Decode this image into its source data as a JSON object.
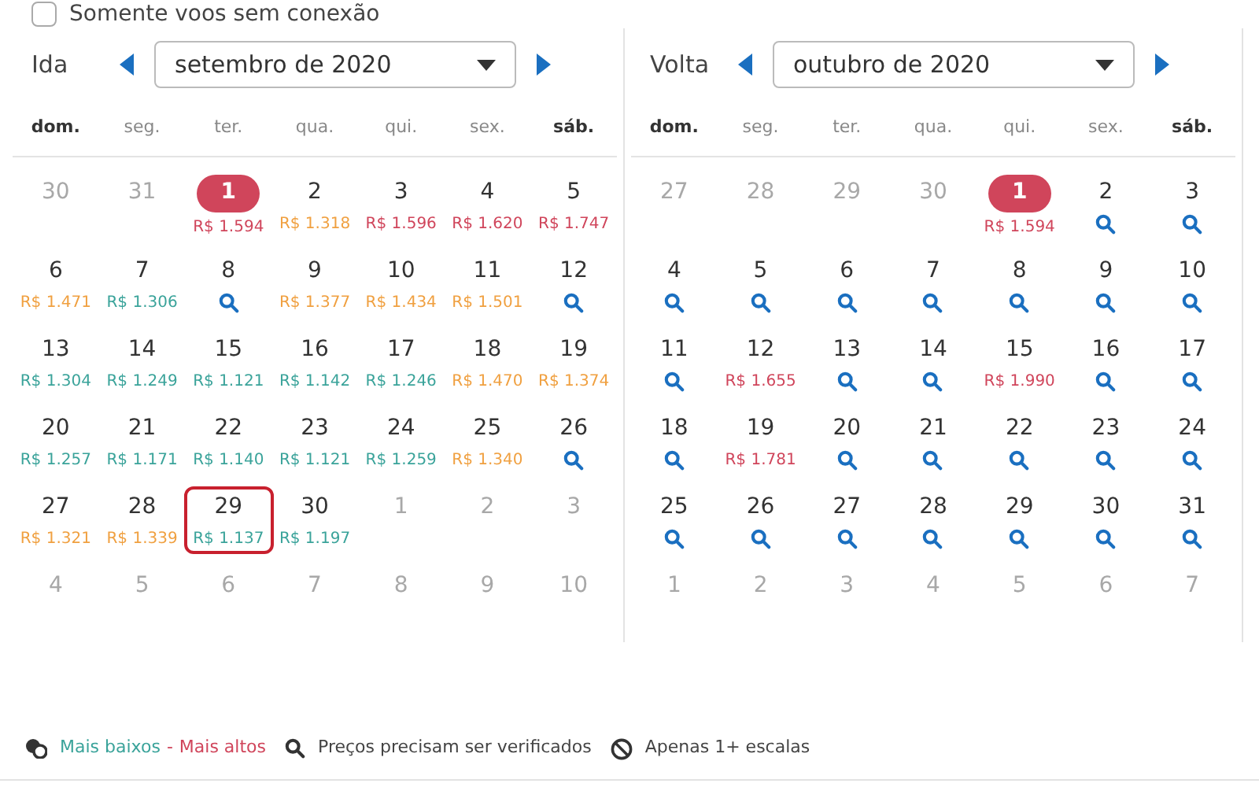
{
  "filter": {
    "label": "Somente voos sem conexão",
    "checked": false
  },
  "calendars": [
    {
      "label": "Ida",
      "month": "setembro de 2020",
      "weekdays": [
        {
          "text": "dom.",
          "weekend": true
        },
        {
          "text": "seg.",
          "weekend": false
        },
        {
          "text": "ter.",
          "weekend": false
        },
        {
          "text": "qua.",
          "weekend": false
        },
        {
          "text": "qui.",
          "weekend": false
        },
        {
          "text": "sex.",
          "weekend": false
        },
        {
          "text": "sáb.",
          "weekend": true
        }
      ],
      "days": [
        {
          "day": "30",
          "kind": "other"
        },
        {
          "day": "31",
          "kind": "other"
        },
        {
          "day": "1",
          "kind": "price",
          "price": "R$ 1.594",
          "color": "#d0455b",
          "selected": true,
          "outlined": false
        },
        {
          "day": "2",
          "kind": "price",
          "price": "R$ 1.318",
          "color": "#f0a040",
          "selected": false,
          "outlined": false
        },
        {
          "day": "3",
          "kind": "price",
          "price": "R$ 1.596",
          "color": "#d0455b",
          "selected": false,
          "outlined": false
        },
        {
          "day": "4",
          "kind": "price",
          "price": "R$ 1.620",
          "color": "#d0455b",
          "selected": false,
          "outlined": false
        },
        {
          "day": "5",
          "kind": "price",
          "price": "R$ 1.747",
          "color": "#d0455b",
          "selected": false,
          "outlined": false
        },
        {
          "day": "6",
          "kind": "price",
          "price": "R$ 1.471",
          "color": "#f0a040",
          "selected": false,
          "outlined": false
        },
        {
          "day": "7",
          "kind": "price",
          "price": "R$ 1.306",
          "color": "#3aa39a",
          "selected": false,
          "outlined": false
        },
        {
          "day": "8",
          "kind": "search",
          "selected": false,
          "outlined": false
        },
        {
          "day": "9",
          "kind": "price",
          "price": "R$ 1.377",
          "color": "#f0a040",
          "selected": false,
          "outlined": false
        },
        {
          "day": "10",
          "kind": "price",
          "price": "R$ 1.434",
          "color": "#f0a040",
          "selected": false,
          "outlined": false
        },
        {
          "day": "11",
          "kind": "price",
          "price": "R$ 1.501",
          "color": "#f0a040",
          "selected": false,
          "outlined": false
        },
        {
          "day": "12",
          "kind": "search",
          "selected": false,
          "outlined": false
        },
        {
          "day": "13",
          "kind": "price",
          "price": "R$ 1.304",
          "color": "#3aa39a",
          "selected": false,
          "outlined": false
        },
        {
          "day": "14",
          "kind": "price",
          "price": "R$ 1.249",
          "color": "#3aa39a",
          "selected": false,
          "outlined": false
        },
        {
          "day": "15",
          "kind": "price",
          "price": "R$ 1.121",
          "color": "#3aa39a",
          "selected": false,
          "outlined": false
        },
        {
          "day": "16",
          "kind": "price",
          "price": "R$ 1.142",
          "color": "#3aa39a",
          "selected": false,
          "outlined": false
        },
        {
          "day": "17",
          "kind": "price",
          "price": "R$ 1.246",
          "color": "#3aa39a",
          "selected": false,
          "outlined": false
        },
        {
          "day": "18",
          "kind": "price",
          "price": "R$ 1.470",
          "color": "#f0a040",
          "selected": false,
          "outlined": false
        },
        {
          "day": "19",
          "kind": "price",
          "price": "R$ 1.374",
          "color": "#f0a040",
          "selected": false,
          "outlined": false
        },
        {
          "day": "20",
          "kind": "price",
          "price": "R$ 1.257",
          "color": "#3aa39a",
          "selected": false,
          "outlined": false
        },
        {
          "day": "21",
          "kind": "price",
          "price": "R$ 1.171",
          "color": "#3aa39a",
          "selected": false,
          "outlined": false
        },
        {
          "day": "22",
          "kind": "price",
          "price": "R$ 1.140",
          "color": "#3aa39a",
          "selected": false,
          "outlined": false
        },
        {
          "day": "23",
          "kind": "price",
          "price": "R$ 1.121",
          "color": "#3aa39a",
          "selected": false,
          "outlined": false
        },
        {
          "day": "24",
          "kind": "price",
          "price": "R$ 1.259",
          "color": "#3aa39a",
          "selected": false,
          "outlined": false
        },
        {
          "day": "25",
          "kind": "price",
          "price": "R$ 1.340",
          "color": "#f0a040",
          "selected": false,
          "outlined": false
        },
        {
          "day": "26",
          "kind": "search",
          "selected": false,
          "outlined": false
        },
        {
          "day": "27",
          "kind": "price",
          "price": "R$ 1.321",
          "color": "#f0a040",
          "selected": false,
          "outlined": false
        },
        {
          "day": "28",
          "kind": "price",
          "price": "R$ 1.339",
          "color": "#f0a040",
          "selected": false,
          "outlined": false
        },
        {
          "day": "29",
          "kind": "price",
          "price": "R$ 1.137",
          "color": "#3aa39a",
          "selected": false,
          "outlined": true
        },
        {
          "day": "30",
          "kind": "price",
          "price": "R$ 1.197",
          "color": "#3aa39a",
          "selected": false,
          "outlined": false
        },
        {
          "day": "1",
          "kind": "other"
        },
        {
          "day": "2",
          "kind": "other"
        },
        {
          "day": "3",
          "kind": "other"
        },
        {
          "day": "4",
          "kind": "other"
        },
        {
          "day": "5",
          "kind": "other"
        },
        {
          "day": "6",
          "kind": "other"
        },
        {
          "day": "7",
          "kind": "other"
        },
        {
          "day": "8",
          "kind": "other"
        },
        {
          "day": "9",
          "kind": "other"
        },
        {
          "day": "10",
          "kind": "other"
        }
      ]
    },
    {
      "label": "Volta",
      "month": "outubro de 2020",
      "weekdays": [
        {
          "text": "dom.",
          "weekend": true
        },
        {
          "text": "seg.",
          "weekend": false
        },
        {
          "text": "ter.",
          "weekend": false
        },
        {
          "text": "qua.",
          "weekend": false
        },
        {
          "text": "qui.",
          "weekend": false
        },
        {
          "text": "sex.",
          "weekend": false
        },
        {
          "text": "sáb.",
          "weekend": true
        }
      ],
      "days": [
        {
          "day": "27",
          "kind": "other"
        },
        {
          "day": "28",
          "kind": "other"
        },
        {
          "day": "29",
          "kind": "other"
        },
        {
          "day": "30",
          "kind": "other"
        },
        {
          "day": "1",
          "kind": "price",
          "price": "R$ 1.594",
          "color": "#d0455b",
          "selected": true,
          "outlined": false
        },
        {
          "day": "2",
          "kind": "search",
          "selected": false,
          "outlined": false
        },
        {
          "day": "3",
          "kind": "search",
          "selected": false,
          "outlined": false
        },
        {
          "day": "4",
          "kind": "search",
          "selected": false,
          "outlined": false
        },
        {
          "day": "5",
          "kind": "search",
          "selected": false,
          "outlined": false
        },
        {
          "day": "6",
          "kind": "search",
          "selected": false,
          "outlined": false
        },
        {
          "day": "7",
          "kind": "search",
          "selected": false,
          "outlined": false
        },
        {
          "day": "8",
          "kind": "search",
          "selected": false,
          "outlined": false
        },
        {
          "day": "9",
          "kind": "search",
          "selected": false,
          "outlined": false
        },
        {
          "day": "10",
          "kind": "search",
          "selected": false,
          "outlined": false
        },
        {
          "day": "11",
          "kind": "search",
          "selected": false,
          "outlined": false
        },
        {
          "day": "12",
          "kind": "price",
          "price": "R$ 1.655",
          "color": "#d0455b",
          "selected": false,
          "outlined": false
        },
        {
          "day": "13",
          "kind": "search",
          "selected": false,
          "outlined": false
        },
        {
          "day": "14",
          "kind": "search",
          "selected": false,
          "outlined": false
        },
        {
          "day": "15",
          "kind": "price",
          "price": "R$ 1.990",
          "color": "#d0455b",
          "selected": false,
          "outlined": false
        },
        {
          "day": "16",
          "kind": "search",
          "selected": false,
          "outlined": false
        },
        {
          "day": "17",
          "kind": "search",
          "selected": false,
          "outlined": false
        },
        {
          "day": "18",
          "kind": "search",
          "selected": false,
          "outlined": false
        },
        {
          "day": "19",
          "kind": "price",
          "price": "R$ 1.781",
          "color": "#d0455b",
          "selected": false,
          "outlined": false
        },
        {
          "day": "20",
          "kind": "search",
          "selected": false,
          "outlined": false
        },
        {
          "day": "21",
          "kind": "search",
          "selected": false,
          "outlined": false
        },
        {
          "day": "22",
          "kind": "search",
          "selected": false,
          "outlined": false
        },
        {
          "day": "23",
          "kind": "search",
          "selected": false,
          "outlined": false
        },
        {
          "day": "24",
          "kind": "search",
          "selected": false,
          "outlined": false
        },
        {
          "day": "25",
          "kind": "search",
          "selected": false,
          "outlined": false
        },
        {
          "day": "26",
          "kind": "search",
          "selected": false,
          "outlined": false
        },
        {
          "day": "27",
          "kind": "search",
          "selected": false,
          "outlined": false
        },
        {
          "day": "28",
          "kind": "search",
          "selected": false,
          "outlined": false
        },
        {
          "day": "29",
          "kind": "search",
          "selected": false,
          "outlined": false
        },
        {
          "day": "30",
          "kind": "search",
          "selected": false,
          "outlined": false
        },
        {
          "day": "31",
          "kind": "search",
          "selected": false,
          "outlined": false
        },
        {
          "day": "1",
          "kind": "other"
        },
        {
          "day": "2",
          "kind": "other"
        },
        {
          "day": "3",
          "kind": "other"
        },
        {
          "day": "4",
          "kind": "other"
        },
        {
          "day": "5",
          "kind": "other"
        },
        {
          "day": "6",
          "kind": "other"
        },
        {
          "day": "7",
          "kind": "other"
        }
      ]
    }
  ],
  "legend": {
    "low": "Mais baixos",
    "separator": "-",
    "high": "Mais altos",
    "verify": "Preços precisam ser verificados",
    "stops": "Apenas 1+ escalas"
  }
}
